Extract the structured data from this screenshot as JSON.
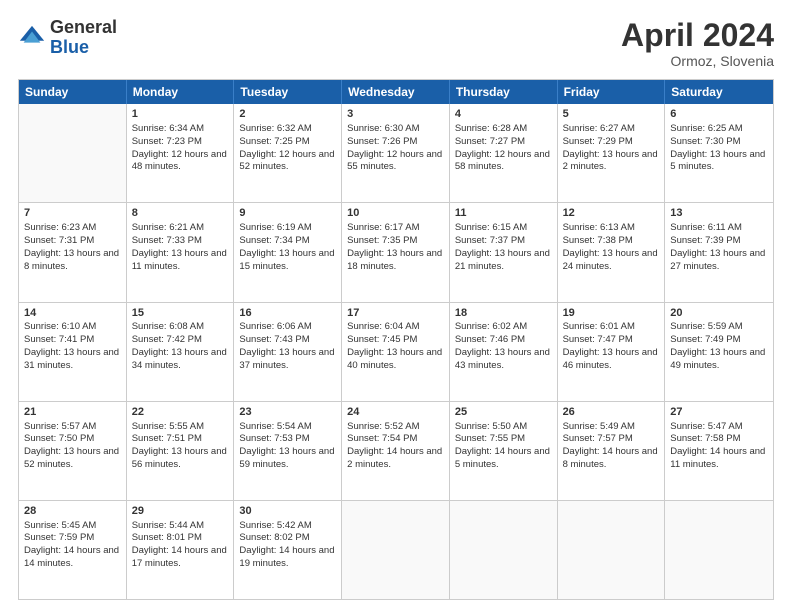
{
  "header": {
    "logo_general": "General",
    "logo_blue": "Blue",
    "month_title": "April 2024",
    "location": "Ormoz, Slovenia"
  },
  "days_of_week": [
    "Sunday",
    "Monday",
    "Tuesday",
    "Wednesday",
    "Thursday",
    "Friday",
    "Saturday"
  ],
  "weeks": [
    [
      {
        "day": "",
        "content": "",
        "empty": true
      },
      {
        "day": "1",
        "sunrise": "Sunrise: 6:34 AM",
        "sunset": "Sunset: 7:23 PM",
        "daylight": "Daylight: 12 hours and 48 minutes."
      },
      {
        "day": "2",
        "sunrise": "Sunrise: 6:32 AM",
        "sunset": "Sunset: 7:25 PM",
        "daylight": "Daylight: 12 hours and 52 minutes."
      },
      {
        "day": "3",
        "sunrise": "Sunrise: 6:30 AM",
        "sunset": "Sunset: 7:26 PM",
        "daylight": "Daylight: 12 hours and 55 minutes."
      },
      {
        "day": "4",
        "sunrise": "Sunrise: 6:28 AM",
        "sunset": "Sunset: 7:27 PM",
        "daylight": "Daylight: 12 hours and 58 minutes."
      },
      {
        "day": "5",
        "sunrise": "Sunrise: 6:27 AM",
        "sunset": "Sunset: 7:29 PM",
        "daylight": "Daylight: 13 hours and 2 minutes."
      },
      {
        "day": "6",
        "sunrise": "Sunrise: 6:25 AM",
        "sunset": "Sunset: 7:30 PM",
        "daylight": "Daylight: 13 hours and 5 minutes."
      }
    ],
    [
      {
        "day": "7",
        "sunrise": "Sunrise: 6:23 AM",
        "sunset": "Sunset: 7:31 PM",
        "daylight": "Daylight: 13 hours and 8 minutes."
      },
      {
        "day": "8",
        "sunrise": "Sunrise: 6:21 AM",
        "sunset": "Sunset: 7:33 PM",
        "daylight": "Daylight: 13 hours and 11 minutes."
      },
      {
        "day": "9",
        "sunrise": "Sunrise: 6:19 AM",
        "sunset": "Sunset: 7:34 PM",
        "daylight": "Daylight: 13 hours and 15 minutes."
      },
      {
        "day": "10",
        "sunrise": "Sunrise: 6:17 AM",
        "sunset": "Sunset: 7:35 PM",
        "daylight": "Daylight: 13 hours and 18 minutes."
      },
      {
        "day": "11",
        "sunrise": "Sunrise: 6:15 AM",
        "sunset": "Sunset: 7:37 PM",
        "daylight": "Daylight: 13 hours and 21 minutes."
      },
      {
        "day": "12",
        "sunrise": "Sunrise: 6:13 AM",
        "sunset": "Sunset: 7:38 PM",
        "daylight": "Daylight: 13 hours and 24 minutes."
      },
      {
        "day": "13",
        "sunrise": "Sunrise: 6:11 AM",
        "sunset": "Sunset: 7:39 PM",
        "daylight": "Daylight: 13 hours and 27 minutes."
      }
    ],
    [
      {
        "day": "14",
        "sunrise": "Sunrise: 6:10 AM",
        "sunset": "Sunset: 7:41 PM",
        "daylight": "Daylight: 13 hours and 31 minutes."
      },
      {
        "day": "15",
        "sunrise": "Sunrise: 6:08 AM",
        "sunset": "Sunset: 7:42 PM",
        "daylight": "Daylight: 13 hours and 34 minutes."
      },
      {
        "day": "16",
        "sunrise": "Sunrise: 6:06 AM",
        "sunset": "Sunset: 7:43 PM",
        "daylight": "Daylight: 13 hours and 37 minutes."
      },
      {
        "day": "17",
        "sunrise": "Sunrise: 6:04 AM",
        "sunset": "Sunset: 7:45 PM",
        "daylight": "Daylight: 13 hours and 40 minutes."
      },
      {
        "day": "18",
        "sunrise": "Sunrise: 6:02 AM",
        "sunset": "Sunset: 7:46 PM",
        "daylight": "Daylight: 13 hours and 43 minutes."
      },
      {
        "day": "19",
        "sunrise": "Sunrise: 6:01 AM",
        "sunset": "Sunset: 7:47 PM",
        "daylight": "Daylight: 13 hours and 46 minutes."
      },
      {
        "day": "20",
        "sunrise": "Sunrise: 5:59 AM",
        "sunset": "Sunset: 7:49 PM",
        "daylight": "Daylight: 13 hours and 49 minutes."
      }
    ],
    [
      {
        "day": "21",
        "sunrise": "Sunrise: 5:57 AM",
        "sunset": "Sunset: 7:50 PM",
        "daylight": "Daylight: 13 hours and 52 minutes."
      },
      {
        "day": "22",
        "sunrise": "Sunrise: 5:55 AM",
        "sunset": "Sunset: 7:51 PM",
        "daylight": "Daylight: 13 hours and 56 minutes."
      },
      {
        "day": "23",
        "sunrise": "Sunrise: 5:54 AM",
        "sunset": "Sunset: 7:53 PM",
        "daylight": "Daylight: 13 hours and 59 minutes."
      },
      {
        "day": "24",
        "sunrise": "Sunrise: 5:52 AM",
        "sunset": "Sunset: 7:54 PM",
        "daylight": "Daylight: 14 hours and 2 minutes."
      },
      {
        "day": "25",
        "sunrise": "Sunrise: 5:50 AM",
        "sunset": "Sunset: 7:55 PM",
        "daylight": "Daylight: 14 hours and 5 minutes."
      },
      {
        "day": "26",
        "sunrise": "Sunrise: 5:49 AM",
        "sunset": "Sunset: 7:57 PM",
        "daylight": "Daylight: 14 hours and 8 minutes."
      },
      {
        "day": "27",
        "sunrise": "Sunrise: 5:47 AM",
        "sunset": "Sunset: 7:58 PM",
        "daylight": "Daylight: 14 hours and 11 minutes."
      }
    ],
    [
      {
        "day": "28",
        "sunrise": "Sunrise: 5:45 AM",
        "sunset": "Sunset: 7:59 PM",
        "daylight": "Daylight: 14 hours and 14 minutes."
      },
      {
        "day": "29",
        "sunrise": "Sunrise: 5:44 AM",
        "sunset": "Sunset: 8:01 PM",
        "daylight": "Daylight: 14 hours and 17 minutes."
      },
      {
        "day": "30",
        "sunrise": "Sunrise: 5:42 AM",
        "sunset": "Sunset: 8:02 PM",
        "daylight": "Daylight: 14 hours and 19 minutes."
      },
      {
        "day": "",
        "content": "",
        "empty": true
      },
      {
        "day": "",
        "content": "",
        "empty": true
      },
      {
        "day": "",
        "content": "",
        "empty": true
      },
      {
        "day": "",
        "content": "",
        "empty": true
      }
    ]
  ]
}
